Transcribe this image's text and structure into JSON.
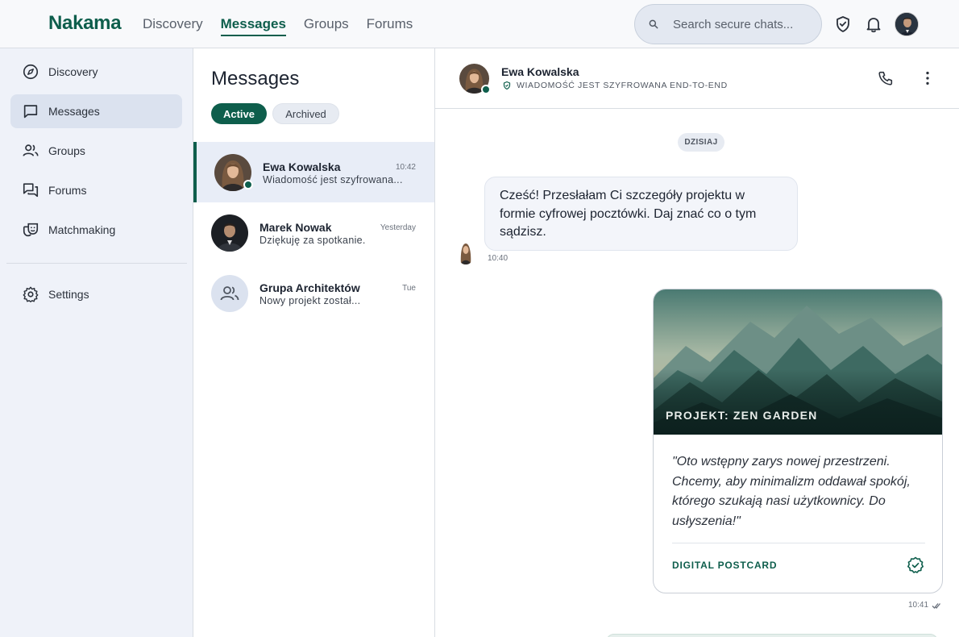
{
  "app": {
    "brand": "Nakama"
  },
  "topnav": [
    {
      "label": "Discovery",
      "active": false
    },
    {
      "label": "Messages",
      "active": true
    },
    {
      "label": "Groups",
      "active": false
    },
    {
      "label": "Forums",
      "active": false
    }
  ],
  "search": {
    "placeholder": "Search secure chats..."
  },
  "top_icons": [
    "shield-check-icon",
    "bell-icon",
    "user-avatar"
  ],
  "sidebar": {
    "items": [
      {
        "label": "Discovery",
        "icon": "compass-icon",
        "active": false
      },
      {
        "label": "Messages",
        "icon": "chat-bubble-icon",
        "active": true
      },
      {
        "label": "Groups",
        "icon": "people-icon",
        "active": false
      },
      {
        "label": "Forums",
        "icon": "forum-icon",
        "active": false
      },
      {
        "label": "Matchmaking",
        "icon": "theater-masks-icon",
        "active": false
      },
      {
        "label": "Settings",
        "icon": "gear-icon",
        "active": false
      }
    ]
  },
  "conversations": {
    "title": "Messages",
    "filters": {
      "active": "Active",
      "archived": "Archived"
    },
    "items": [
      {
        "name": "Ewa Kowalska",
        "time": "10:42",
        "preview": "Wiadomość jest szyfrowana...",
        "selected": true,
        "online": true
      },
      {
        "name": "Marek Nowak",
        "time": "Yesterday",
        "preview": "Dziękuję za spotkanie.",
        "selected": false,
        "online": false
      },
      {
        "name": "Grupa Architektów",
        "time": "Tue",
        "preview": "Nowy projekt został...",
        "selected": false,
        "online": false
      }
    ]
  },
  "chat": {
    "contact_name": "Ewa Kowalska",
    "encryption_note": "WIADOMOŚĆ JEST SZYFROWANA END-TO-END",
    "day_label": "DZISIAJ",
    "incoming": {
      "text": "Cześć! Przesłałam Ci szczegóły projektu w formie cyfrowej pocztówki. Daj znać co o tym sądzisz.",
      "time": "10:40"
    },
    "postcard": {
      "title": "PROJEKT: ZEN GARDEN",
      "quote": "\"Oto wstępny zarys nowej przestrzeni. Chcemy, aby minimalizm oddawał spokój, którego szukają nasi użytkownicy. Do usłyszenia!\"",
      "label": "DIGITAL POSTCARD",
      "time": "10:41"
    }
  },
  "colors": {
    "accent": "#0e5e4c",
    "selected_bg": "#e8edf7",
    "sidebar_bg": "#eff2f9"
  }
}
